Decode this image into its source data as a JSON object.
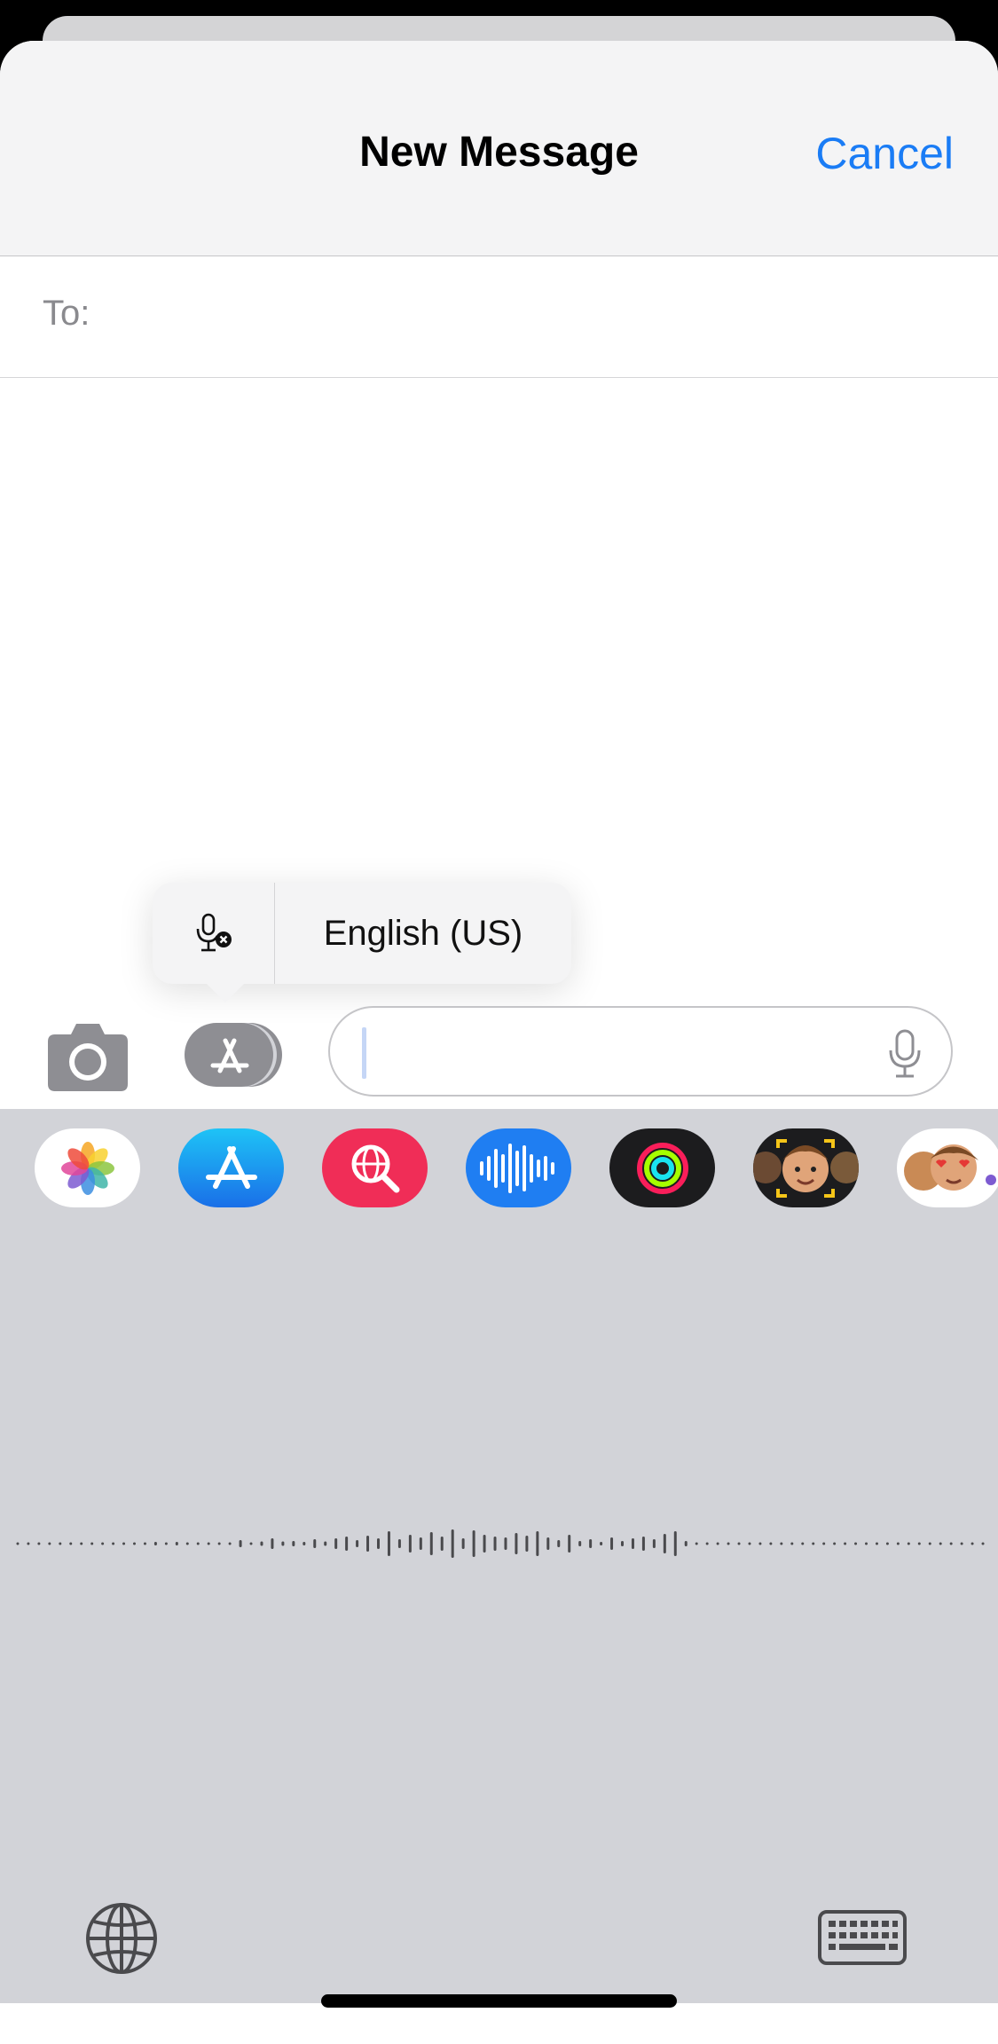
{
  "nav": {
    "title": "New Message",
    "cancel_label": "Cancel"
  },
  "recipient": {
    "label": "To:",
    "value": ""
  },
  "dictation_popup": {
    "language": "English (US)",
    "mic_icon": "microphone-slash-icon"
  },
  "composer": {
    "value": "",
    "mic_icon": "microphone-icon",
    "camera_icon": "camera-icon",
    "apps_icon": "app-store-icon"
  },
  "app_drawer": {
    "apps": [
      {
        "name": "Photos",
        "icon": "photos-icon"
      },
      {
        "name": "App Store",
        "icon": "app-store-icon"
      },
      {
        "name": "Images Search",
        "icon": "globe-search-icon"
      },
      {
        "name": "Audio",
        "icon": "audio-wave-icon"
      },
      {
        "name": "Activity",
        "icon": "activity-rings-icon"
      },
      {
        "name": "Memoji",
        "icon": "memoji-icon"
      },
      {
        "name": "Memoji Stickers",
        "icon": "memoji-stickers-icon"
      }
    ]
  },
  "keyboard": {
    "globe_icon": "globe-icon",
    "keyboard_icon": "keyboard-icon"
  },
  "colors": {
    "accent": "#1a7cf5",
    "drawer_bg": "#d2d3d8",
    "nav_bg": "#f4f4f5"
  }
}
